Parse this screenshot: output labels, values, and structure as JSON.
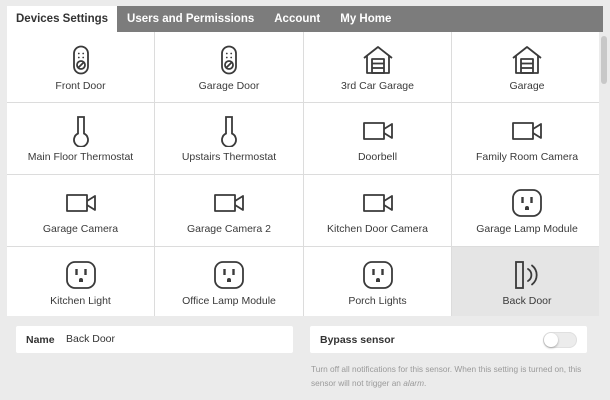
{
  "tabs": [
    {
      "label": "Devices Settings",
      "active": true
    },
    {
      "label": "Users and Permissions",
      "active": false
    },
    {
      "label": "Account",
      "active": false
    },
    {
      "label": "My Home",
      "active": false
    }
  ],
  "devices": [
    {
      "label": "Front Door",
      "icon": "door-lock-icon"
    },
    {
      "label": "Garage Door",
      "icon": "door-lock-icon"
    },
    {
      "label": "3rd Car Garage",
      "icon": "garage-icon"
    },
    {
      "label": "Garage",
      "icon": "garage-icon"
    },
    {
      "label": "Main Floor Thermostat",
      "icon": "thermostat-icon"
    },
    {
      "label": "Upstairs Thermostat",
      "icon": "thermostat-icon"
    },
    {
      "label": "Doorbell",
      "icon": "camera-icon"
    },
    {
      "label": "Family Room Camera",
      "icon": "camera-icon"
    },
    {
      "label": "Garage Camera",
      "icon": "camera-icon"
    },
    {
      "label": "Garage Camera 2",
      "icon": "camera-icon"
    },
    {
      "label": "Kitchen Door Camera",
      "icon": "camera-icon"
    },
    {
      "label": "Garage Lamp Module",
      "icon": "outlet-icon"
    },
    {
      "label": "Kitchen Light",
      "icon": "outlet-icon"
    },
    {
      "label": "Office Lamp Module",
      "icon": "outlet-icon"
    },
    {
      "label": "Porch Lights",
      "icon": "outlet-icon"
    },
    {
      "label": "Back Door",
      "icon": "door-sensor-icon",
      "selected": true
    }
  ],
  "settings": {
    "name_label": "Name",
    "name_value": "Back Door",
    "bypass_label": "Bypass sensor",
    "bypass_on": false,
    "help_text": "Turn off all notifications for this sensor. When this setting is turned on, this sensor will not trigger an ",
    "help_emphasis": "alarm",
    "help_end": "."
  },
  "colors": {
    "tab_bar": "#7c7c7c",
    "icon_stroke": "#3a3a3a",
    "background": "#ebebeb"
  }
}
